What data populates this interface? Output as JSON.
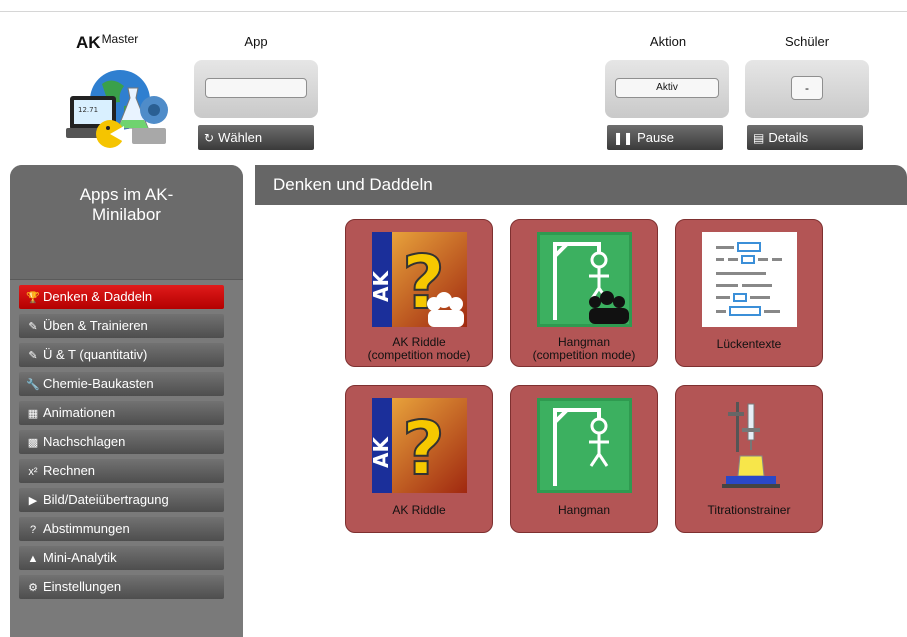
{
  "header": {
    "brand_main": "AK",
    "brand_sup": "Master",
    "app": {
      "label": "App",
      "field_value": "",
      "button": "Wählen",
      "button_icon": "refresh-icon"
    },
    "aktion": {
      "label": "Aktion",
      "field_value": "Aktiv",
      "button": "Pause",
      "button_icon": "pause-icon"
    },
    "schueler": {
      "label": "Schüler",
      "field_value": "-",
      "button": "Details",
      "button_icon": "list-icon"
    }
  },
  "sidebar": {
    "title_line1": "Apps im AK-",
    "title_line2": "Minilabor",
    "items": [
      {
        "label": "Denken & Daddeln",
        "icon": "trophy-icon",
        "active": true
      },
      {
        "label": "Üben & Trainieren",
        "icon": "edit-icon",
        "active": false
      },
      {
        "label": "Ü & T (quantitativ)",
        "icon": "edit-icon",
        "active": false
      },
      {
        "label": "Chemie-Baukasten",
        "icon": "wrench-icon",
        "active": false
      },
      {
        "label": "Animationen",
        "icon": "film-icon",
        "active": false
      },
      {
        "label": "Nachschlagen",
        "icon": "book-icon",
        "active": false
      },
      {
        "label": "Rechnen",
        "icon": "superscript-icon",
        "icon_text": "x²",
        "active": false
      },
      {
        "label": "Bild/Dateiübertragung",
        "icon": "camera-icon",
        "active": false
      },
      {
        "label": "Abstimmungen",
        "icon": "question-icon",
        "icon_text": "?",
        "active": false
      },
      {
        "label": "Mini-Analytik",
        "icon": "flask-icon",
        "active": false
      },
      {
        "label": "Einstellungen",
        "icon": "gear-icon",
        "active": false
      }
    ]
  },
  "main": {
    "title": "Denken und Daddeln",
    "tiles": [
      {
        "line1": "AK Riddle",
        "line2": "(competition mode)",
        "icon": "ak-riddle-icon"
      },
      {
        "line1": "Hangman",
        "line2": "(competition mode)",
        "icon": "hangman-icon"
      },
      {
        "line1": "Lückentexte",
        "line2": "",
        "icon": "cloze-text-icon"
      },
      {
        "line1": "AK Riddle",
        "line2": "",
        "icon": "ak-riddle-icon"
      },
      {
        "line1": "Hangman",
        "line2": "",
        "icon": "hangman-icon"
      },
      {
        "line1": "Titrationstrainer",
        "line2": "",
        "icon": "titration-icon"
      }
    ]
  },
  "colors": {
    "active_nav": "#cc1111",
    "tile_bg": "#b35555",
    "sidebar_bg": "#7a7a7a",
    "header_bar": "#666666"
  }
}
